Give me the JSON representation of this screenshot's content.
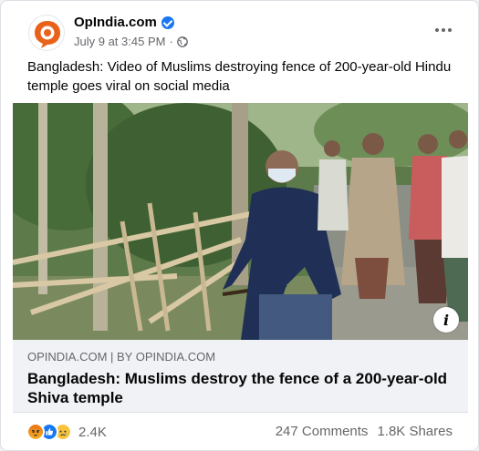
{
  "post": {
    "page_name": "OpIndia.com",
    "date": "July 9 at 3:45 PM",
    "separator": "·",
    "caption": "Bangladesh: Video of Muslims destroying fence of 200-year-old Hindu temple goes viral on social media"
  },
  "link": {
    "domain": "OPINDIA.COM | BY OPINDIA.COM",
    "title": "Bangladesh: Muslims destroy the fence of a 200-year-old Shiva temple"
  },
  "footer": {
    "reaction_count": "2.4K",
    "comments": "247 Comments",
    "shares": "1.8K Shares"
  },
  "icons": {
    "verified": "verified-badge-icon",
    "audience": "globe-icon",
    "more": "more-options-icon",
    "info": "info-icon",
    "reactions": [
      "angry-reaction-icon",
      "like-reaction-icon",
      "sad-reaction-icon"
    ]
  },
  "colors": {
    "facebook_blue": "#1877f2",
    "brand_orange": "#e8621a",
    "secondary_text": "#65676b"
  }
}
